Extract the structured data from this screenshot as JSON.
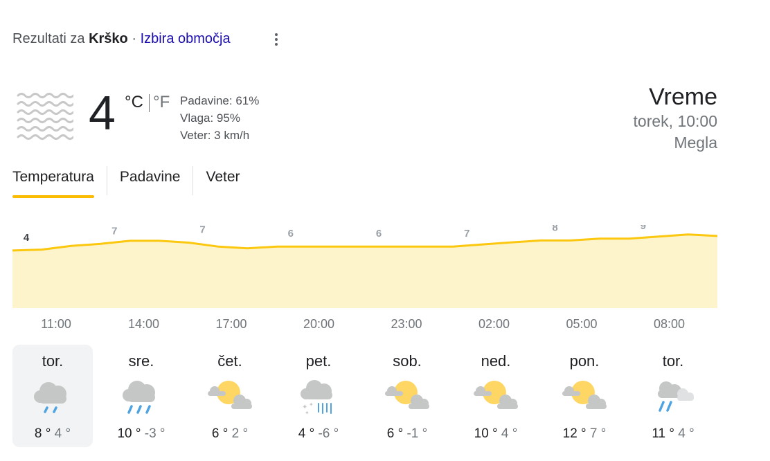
{
  "header": {
    "results_prefix": "Rezultati za",
    "location": "Krško",
    "dot": "·",
    "change_location": "Izbira območja",
    "menu_icon": "more-vert-icon"
  },
  "current": {
    "icon": "fog-icon",
    "temperature": "4",
    "unit_c": "°C",
    "unit_f": "°F",
    "precipitation": "Padavine: 61%",
    "humidity": "Vlaga: 95%",
    "wind": "Veter: 3 km/h",
    "title": "Vreme",
    "datetime": "torek, 10:00",
    "condition": "Megla"
  },
  "tabs": [
    {
      "label": "Temperatura",
      "active": true
    },
    {
      "label": "Padavine",
      "active": false
    },
    {
      "label": "Veter",
      "active": false
    }
  ],
  "colors": {
    "line": "#fbc70f",
    "fill": "#fef4cc",
    "tab_underline": "#fbbc04",
    "link": "#1a0dab"
  },
  "chart_data": {
    "type": "area",
    "x": [
      "10:00",
      "11:00",
      "12:00",
      "13:00",
      "14:00",
      "15:00",
      "16:00",
      "17:00",
      "18:00",
      "19:00",
      "20:00",
      "21:00",
      "22:00",
      "23:00",
      "00:00",
      "01:00",
      "02:00",
      "03:00",
      "04:00",
      "05:00",
      "06:00",
      "07:00",
      "08:00",
      "09:00",
      "10:00"
    ],
    "values": [
      4,
      4.3,
      5.5,
      6.2,
      7.2,
      7.2,
      6.6,
      5.3,
      4.7,
      5.3,
      5.3,
      5.3,
      5.3,
      5.3,
      5.3,
      5.3,
      6,
      6.7,
      7.3,
      7.3,
      7.9,
      7.9,
      8.6,
      9.3,
      8.8
    ],
    "labels": [
      {
        "text": "4",
        "value": 4,
        "x_index": 0,
        "bold": true
      },
      {
        "text": "7",
        "value": 7,
        "x_index": 3
      },
      {
        "text": "7",
        "value": 7,
        "x_index": 6
      },
      {
        "text": "6",
        "value": 6,
        "x_index": 9
      },
      {
        "text": "6",
        "value": 6,
        "x_index": 12
      },
      {
        "text": "7",
        "value": 7,
        "x_index": 15
      },
      {
        "text": "8",
        "value": 8,
        "x_index": 18
      },
      {
        "text": "9",
        "value": 9,
        "x_index": 21
      }
    ],
    "ylim": [
      -15,
      9
    ],
    "grid": false
  },
  "hours": [
    "11:00",
    "14:00",
    "17:00",
    "20:00",
    "23:00",
    "02:00",
    "05:00",
    "08:00"
  ],
  "days": [
    {
      "name": "tor.",
      "icon": "rain-icon",
      "high": "8 °",
      "low": "4 °",
      "selected": true
    },
    {
      "name": "sre.",
      "icon": "heavy-rain-icon",
      "high": "10 °",
      "low": "-3 °",
      "selected": false
    },
    {
      "name": "čet.",
      "icon": "partly-cloudy-icon",
      "high": "6 °",
      "low": "2 °",
      "selected": false
    },
    {
      "name": "pet.",
      "icon": "rain-snow-icon",
      "high": "4 °",
      "low": "-6 °",
      "selected": false
    },
    {
      "name": "sob.",
      "icon": "partly-cloudy-icon",
      "high": "6 °",
      "low": "-1 °",
      "selected": false
    },
    {
      "name": "ned.",
      "icon": "partly-cloudy-icon",
      "high": "10 °",
      "low": "4 °",
      "selected": false
    },
    {
      "name": "pon.",
      "icon": "partly-cloudy-icon",
      "high": "12 °",
      "low": "7 °",
      "selected": false
    },
    {
      "name": "tor.",
      "icon": "showers-icon",
      "high": "11 °",
      "low": "4 °",
      "selected": false
    }
  ]
}
